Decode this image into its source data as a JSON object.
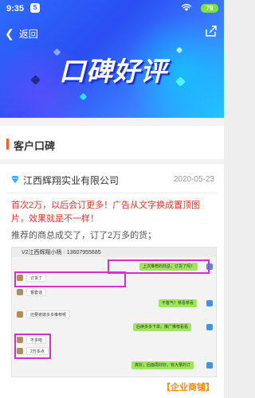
{
  "status_bar": {
    "time": "9:35",
    "s_badge": "S",
    "battery": "79"
  },
  "nav": {
    "back_label": "返回"
  },
  "banner": {
    "title": "口碑好评"
  },
  "section": {
    "title": "客户口碑"
  },
  "post": {
    "company": "江西辉翔实业有限公司",
    "date": "2020-05-23",
    "text_red": "首次2万，以后会订更多！广告从文字换成置顶图片，效果就是不一样！",
    "text": "推荐的商总成交了，订了2万多的货；",
    "shop_tag": "【企业商铺】"
  },
  "chat": {
    "title": "V2江西辉翔小杨 · 13607955685",
    "messages": [
      {
        "text": "上次推荐的商总，订货了吗？",
        "side": "right"
      },
      {
        "text": "订货了",
        "side": "left"
      },
      {
        "text": "客套话",
        "side": "left"
      },
      {
        "text": "不客气！恭喜恭喜",
        "side": "right"
      },
      {
        "text": "还要谢谢多多推荐呢",
        "side": "left"
      },
      {
        "text": "后续多多下单，推广推荐看看",
        "side": "right"
      },
      {
        "text": "不多啦",
        "side": "left"
      },
      {
        "text": "2万多点",
        "side": "left"
      },
      {
        "text": "真好，后面再好好，有大量的订",
        "side": "right"
      }
    ]
  },
  "colors": {
    "accent": "#ff5a1f",
    "red_text": "#e8322c",
    "shop_tag": "#ff8a00",
    "highlight": "#d630c9"
  },
  "icons": {
    "back": "chevron-left-icon",
    "share": "share-icon",
    "wifi": "wifi-icon",
    "diamond": "diamond-icon"
  }
}
